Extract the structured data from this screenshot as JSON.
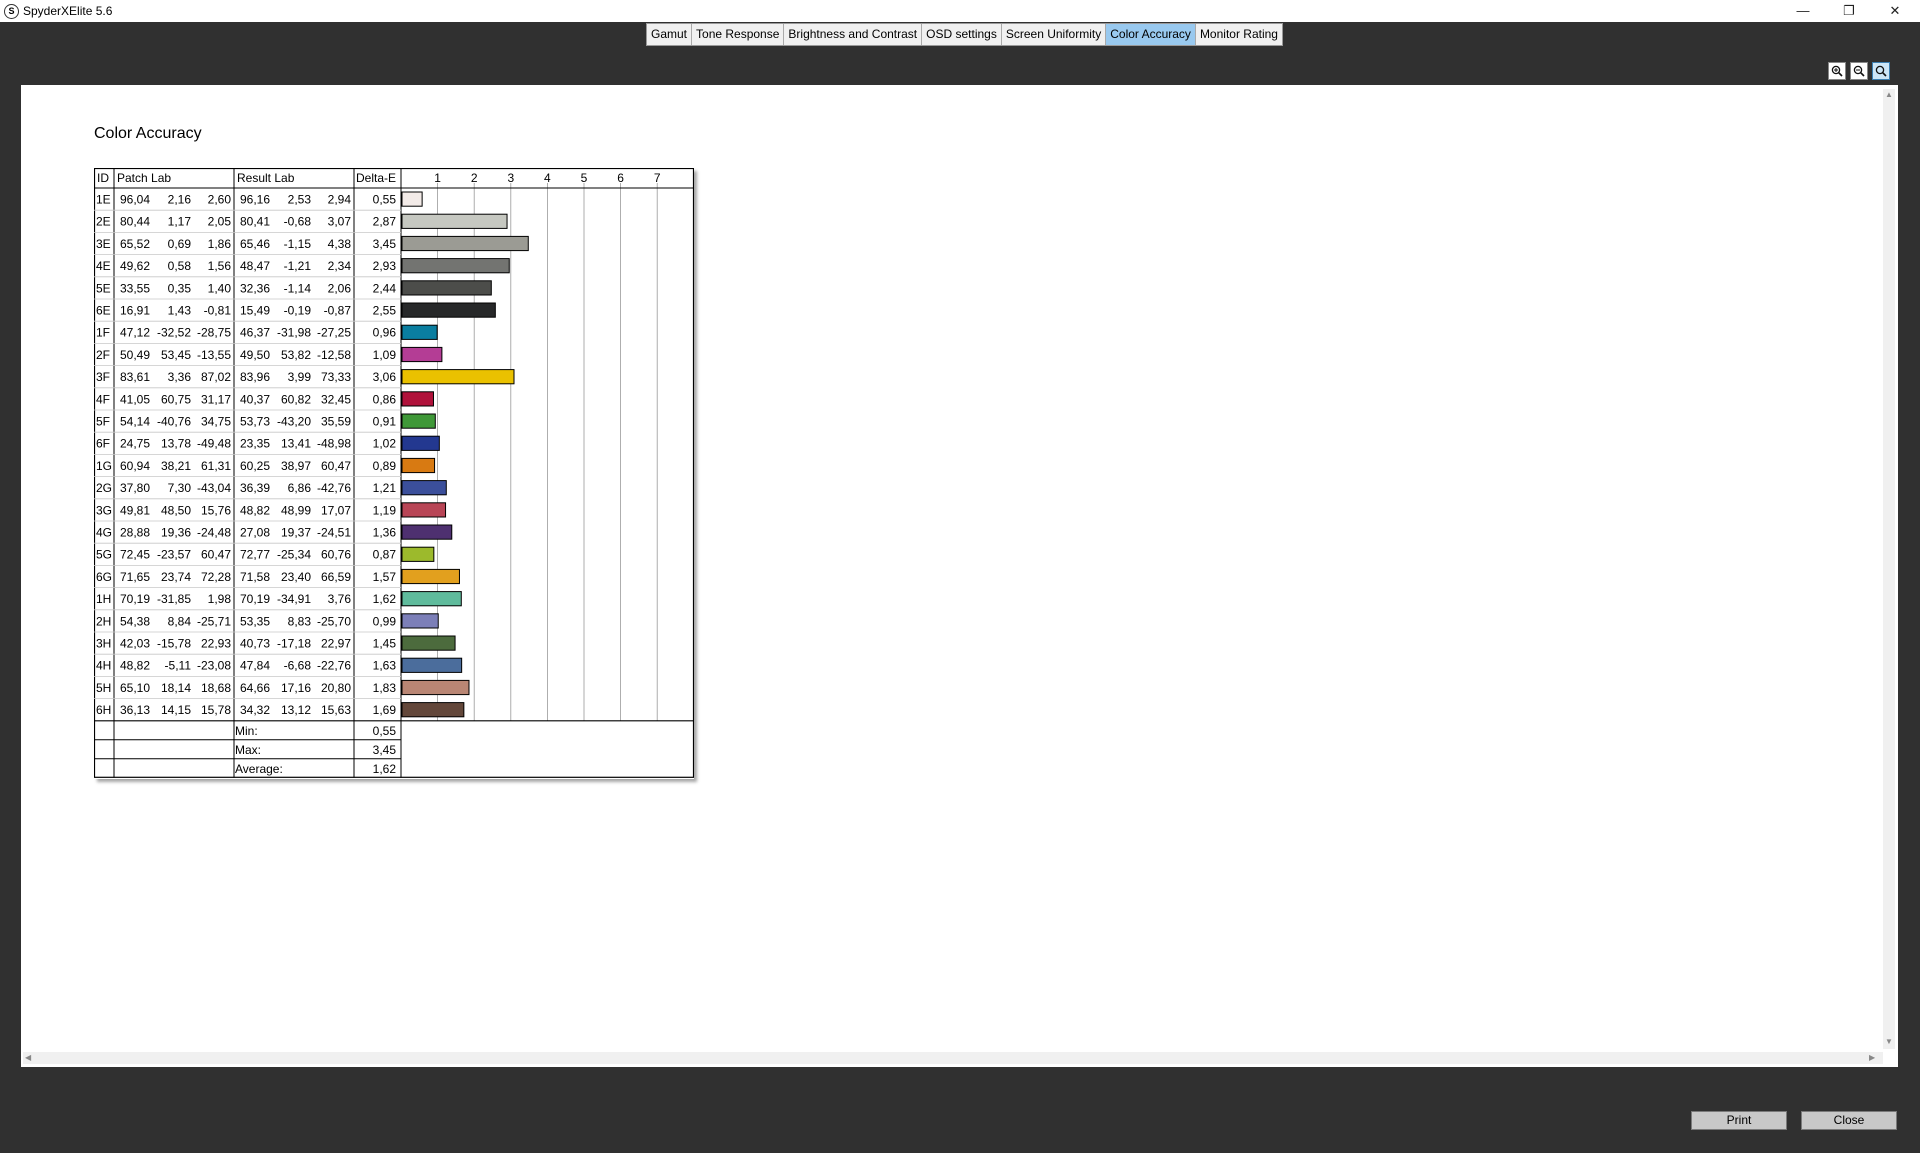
{
  "window": {
    "title": "SpyderXElite 5.6",
    "app_icon_letter": "S",
    "minimize_glyph": "—",
    "maximize_glyph": "❐",
    "close_glyph": "✕"
  },
  "tabs": [
    {
      "label": "Gamut",
      "active": false
    },
    {
      "label": "Tone Response",
      "active": false
    },
    {
      "label": "Brightness and Contrast",
      "active": false
    },
    {
      "label": "OSD settings",
      "active": false
    },
    {
      "label": "Screen Uniformity",
      "active": false
    },
    {
      "label": "Color Accuracy",
      "active": true
    },
    {
      "label": "Monitor Rating",
      "active": false
    }
  ],
  "zoom_tools": [
    {
      "name": "zoom-in-icon",
      "active": false
    },
    {
      "name": "zoom-out-icon",
      "active": false
    },
    {
      "name": "zoom-fit-icon",
      "active": true
    }
  ],
  "report": {
    "title": "Color Accuracy",
    "headers": {
      "id": "ID",
      "patch": "Patch Lab",
      "result": "Result Lab",
      "delta": "Delta-E"
    },
    "summary": [
      {
        "label": "Min:",
        "value": "0,55"
      },
      {
        "label": "Max:",
        "value": "3,45"
      },
      {
        "label": "Average:",
        "value": "1,62"
      }
    ]
  },
  "chart_data": {
    "type": "bar",
    "orientation": "horizontal",
    "xlim": [
      0,
      8
    ],
    "ticks": [
      "1",
      "2",
      "3",
      "4",
      "5",
      "6",
      "7"
    ],
    "grid": true,
    "rows": [
      {
        "id": "1E",
        "patch": [
          "96,04",
          "2,16",
          "2,60"
        ],
        "result": [
          "96,16",
          "2,53",
          "2,94"
        ],
        "delta": "0,55",
        "value": 0.55,
        "color": "#f3ebe8"
      },
      {
        "id": "2E",
        "patch": [
          "80,44",
          "1,17",
          "2,05"
        ],
        "result": [
          "80,41",
          "-0,68",
          "3,07"
        ],
        "delta": "2,87",
        "value": 2.87,
        "color": "#c6c8c1"
      },
      {
        "id": "3E",
        "patch": [
          "65,52",
          "0,69",
          "1,86"
        ],
        "result": [
          "65,46",
          "-1,15",
          "4,38"
        ],
        "delta": "3,45",
        "value": 3.45,
        "color": "#9b9b94"
      },
      {
        "id": "4E",
        "patch": [
          "49,62",
          "0,58",
          "1,56"
        ],
        "result": [
          "48,47",
          "-1,21",
          "2,34"
        ],
        "delta": "2,93",
        "value": 2.93,
        "color": "#737471"
      },
      {
        "id": "5E",
        "patch": [
          "33,55",
          "0,35",
          "1,40"
        ],
        "result": [
          "32,36",
          "-1,14",
          "2,06"
        ],
        "delta": "2,44",
        "value": 2.44,
        "color": "#4c4d4a"
      },
      {
        "id": "6E",
        "patch": [
          "16,91",
          "1,43",
          "-0,81"
        ],
        "result": [
          "15,49",
          "-0,19",
          "-0,87"
        ],
        "delta": "2,55",
        "value": 2.55,
        "color": "#272829"
      },
      {
        "id": "1F",
        "patch": [
          "47,12",
          "-32,52",
          "-28,75"
        ],
        "result": [
          "46,37",
          "-31,98",
          "-27,25"
        ],
        "delta": "0,96",
        "value": 0.96,
        "color": "#0a7ea0"
      },
      {
        "id": "2F",
        "patch": [
          "50,49",
          "53,45",
          "-13,55"
        ],
        "result": [
          "49,50",
          "53,82",
          "-12,58"
        ],
        "delta": "1,09",
        "value": 1.09,
        "color": "#b43d95"
      },
      {
        "id": "3F",
        "patch": [
          "83,61",
          "3,36",
          "87,02"
        ],
        "result": [
          "83,96",
          "3,99",
          "73,33"
        ],
        "delta": "3,06",
        "value": 3.06,
        "color": "#eac100"
      },
      {
        "id": "4F",
        "patch": [
          "41,05",
          "60,75",
          "31,17"
        ],
        "result": [
          "40,37",
          "60,82",
          "32,45"
        ],
        "delta": "0,86",
        "value": 0.86,
        "color": "#b0123b"
      },
      {
        "id": "5F",
        "patch": [
          "54,14",
          "-40,76",
          "34,75"
        ],
        "result": [
          "53,73",
          "-43,20",
          "35,59"
        ],
        "delta": "0,91",
        "value": 0.91,
        "color": "#3f9838"
      },
      {
        "id": "6F",
        "patch": [
          "24,75",
          "13,78",
          "-49,48"
        ],
        "result": [
          "23,35",
          "13,41",
          "-48,98"
        ],
        "delta": "1,02",
        "value": 1.02,
        "color": "#233890"
      },
      {
        "id": "1G",
        "patch": [
          "60,94",
          "38,21",
          "61,31"
        ],
        "result": [
          "60,25",
          "38,97",
          "60,47"
        ],
        "delta": "0,89",
        "value": 0.89,
        "color": "#d87a12"
      },
      {
        "id": "2G",
        "patch": [
          "37,80",
          "7,30",
          "-43,04"
        ],
        "result": [
          "36,39",
          "6,86",
          "-42,76"
        ],
        "delta": "1,21",
        "value": 1.21,
        "color": "#3b4f9b"
      },
      {
        "id": "3G",
        "patch": [
          "49,81",
          "48,50",
          "15,76"
        ],
        "result": [
          "48,82",
          "48,99",
          "17,07"
        ],
        "delta": "1,19",
        "value": 1.19,
        "color": "#b84556"
      },
      {
        "id": "4G",
        "patch": [
          "28,88",
          "19,36",
          "-24,48"
        ],
        "result": [
          "27,08",
          "19,37",
          "-24,51"
        ],
        "delta": "1,36",
        "value": 1.36,
        "color": "#4e3070"
      },
      {
        "id": "5G",
        "patch": [
          "72,45",
          "-23,57",
          "60,47"
        ],
        "result": [
          "72,77",
          "-25,34",
          "60,76"
        ],
        "delta": "0,87",
        "value": 0.87,
        "color": "#9cba2c"
      },
      {
        "id": "6G",
        "patch": [
          "71,65",
          "23,74",
          "72,28"
        ],
        "result": [
          "71,58",
          "23,40",
          "66,59"
        ],
        "delta": "1,57",
        "value": 1.57,
        "color": "#e2a01e"
      },
      {
        "id": "1H",
        "patch": [
          "70,19",
          "-31,85",
          "1,98"
        ],
        "result": [
          "70,19",
          "-34,91",
          "3,76"
        ],
        "delta": "1,62",
        "value": 1.62,
        "color": "#5fbb9c"
      },
      {
        "id": "2H",
        "patch": [
          "54,38",
          "8,84",
          "-25,71"
        ],
        "result": [
          "53,35",
          "8,83",
          "-25,70"
        ],
        "delta": "0,99",
        "value": 0.99,
        "color": "#7c7fb8"
      },
      {
        "id": "3H",
        "patch": [
          "42,03",
          "-15,78",
          "22,93"
        ],
        "result": [
          "40,73",
          "-17,18",
          "22,97"
        ],
        "delta": "1,45",
        "value": 1.45,
        "color": "#4c6b3d"
      },
      {
        "id": "4H",
        "patch": [
          "48,82",
          "-5,11",
          "-23,08"
        ],
        "result": [
          "47,84",
          "-6,68",
          "-22,76"
        ],
        "delta": "1,63",
        "value": 1.63,
        "color": "#4b6d9c"
      },
      {
        "id": "5H",
        "patch": [
          "65,10",
          "18,14",
          "18,68"
        ],
        "result": [
          "64,66",
          "17,16",
          "20,80"
        ],
        "delta": "1,83",
        "value": 1.83,
        "color": "#b98674"
      },
      {
        "id": "6H",
        "patch": [
          "36,13",
          "14,15",
          "15,78"
        ],
        "result": [
          "34,32",
          "13,12",
          "15,63"
        ],
        "delta": "1,69",
        "value": 1.69,
        "color": "#63473a"
      }
    ]
  },
  "buttons": {
    "print": "Print",
    "close": "Close"
  }
}
